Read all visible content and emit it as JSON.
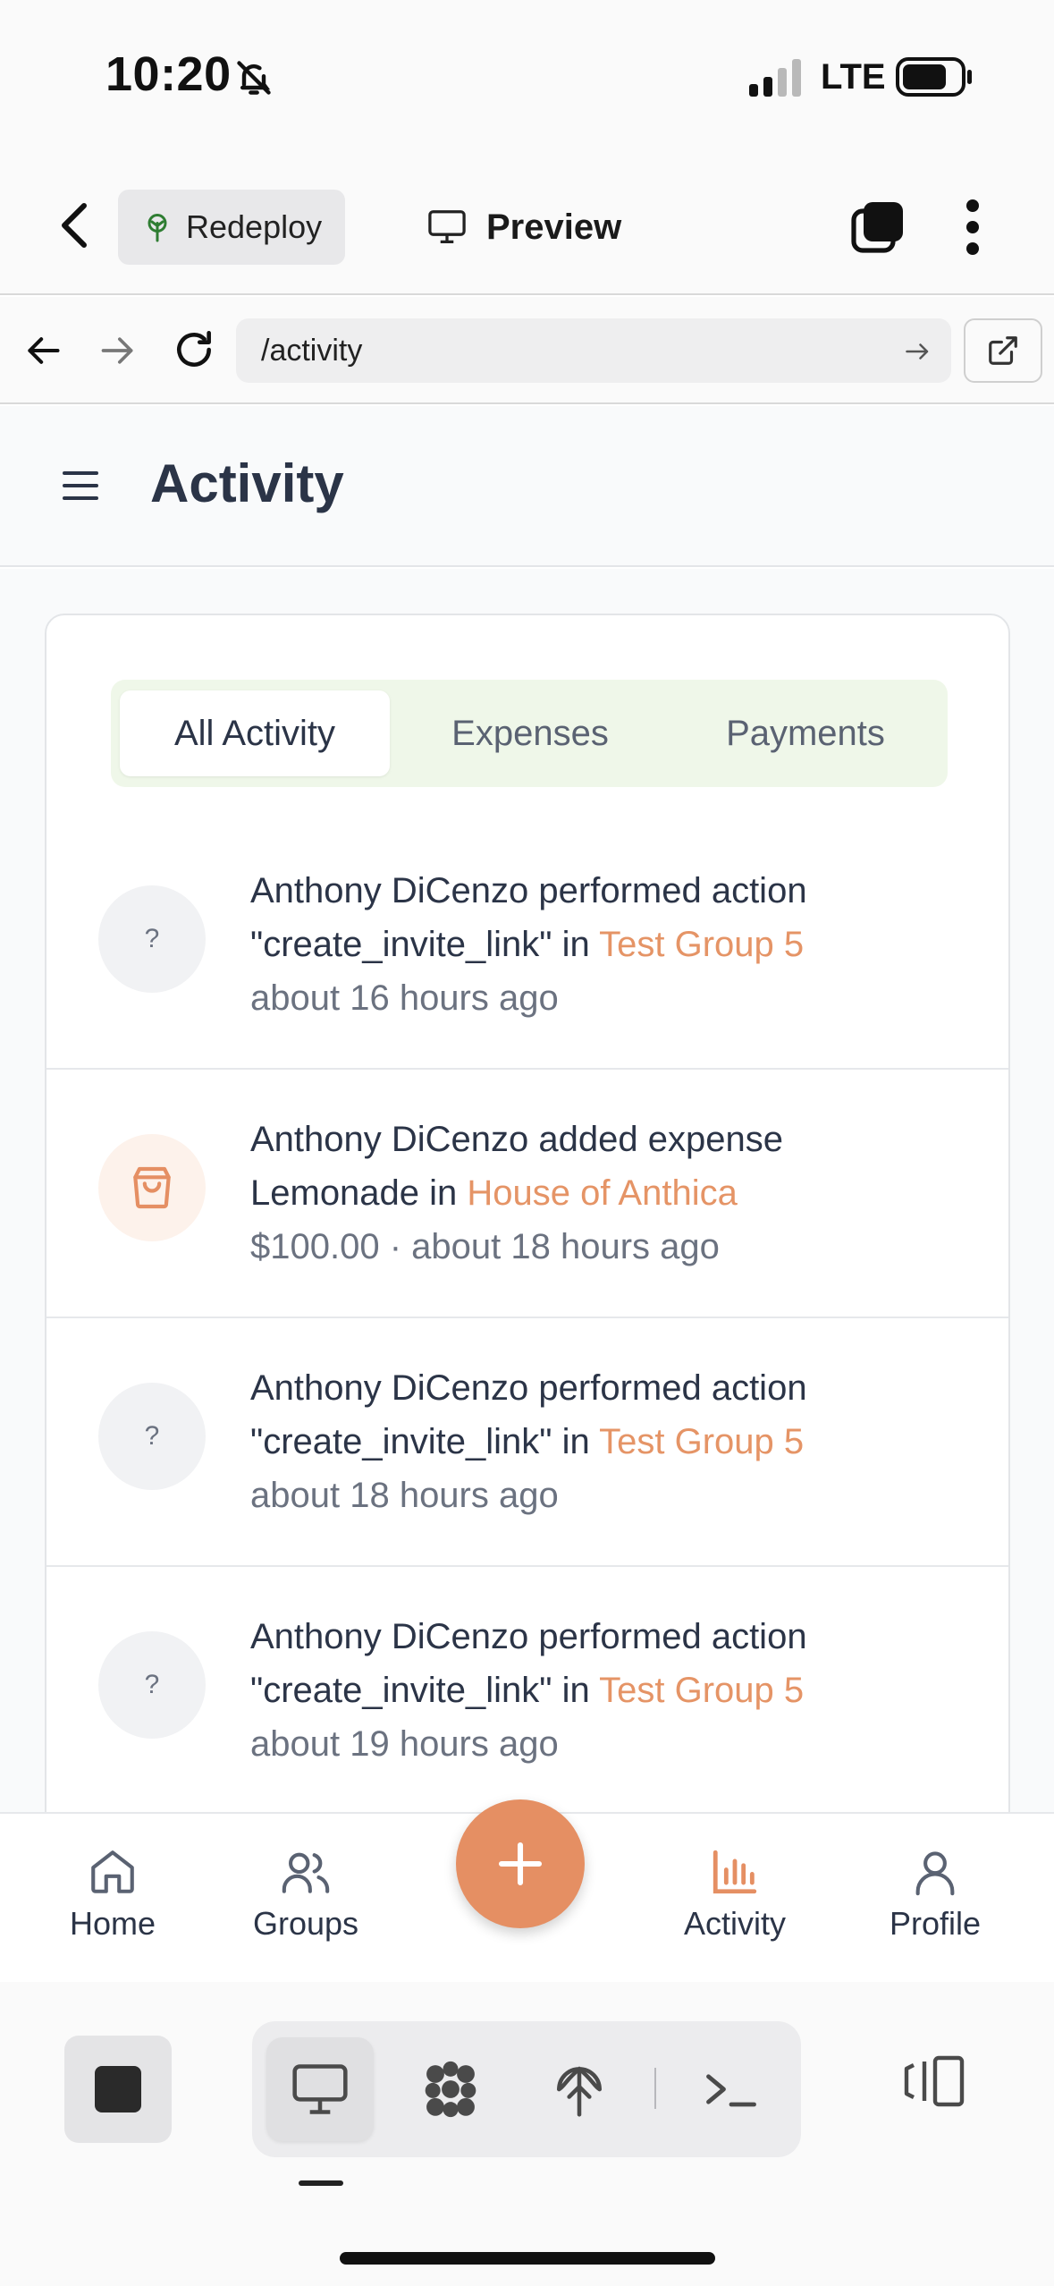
{
  "status_bar": {
    "time": "10:20",
    "network": "LTE"
  },
  "toolbar": {
    "redeploy_label": "Redeploy",
    "preview_label": "Preview"
  },
  "address_bar": {
    "url": "/activity"
  },
  "header": {
    "title": "Activity"
  },
  "filter_tabs": [
    {
      "label": "All Activity",
      "active": true
    },
    {
      "label": "Expenses",
      "active": false
    },
    {
      "label": "Payments",
      "active": false
    }
  ],
  "feed": [
    {
      "avatar": "?",
      "icon": "unknown",
      "line1": "Anthony DiCenzo performed action",
      "line2_prefix": "\"create_invite_link\" in ",
      "group": "Test Group 5",
      "meta": "about 16 hours ago"
    },
    {
      "avatar": "",
      "icon": "shopping-bag-icon",
      "line1": "Anthony DiCenzo added expense",
      "line2_prefix": "Lemonade in ",
      "group": "House of Anthica",
      "meta": "$100.00 · about 18 hours ago"
    },
    {
      "avatar": "?",
      "icon": "unknown",
      "line1": "Anthony DiCenzo performed action",
      "line2_prefix": "\"create_invite_link\" in ",
      "group": "Test Group 5",
      "meta": "about 18 hours ago"
    },
    {
      "avatar": "?",
      "icon": "unknown",
      "line1": "Anthony DiCenzo performed action",
      "line2_prefix": "\"create_invite_link\" in ",
      "group": "Test Group 5",
      "meta": "about 19 hours ago"
    }
  ],
  "bottom_nav": {
    "home": "Home",
    "groups": "Groups",
    "activity": "Activity",
    "profile": "Profile"
  },
  "colors": {
    "accent": "#e58f63",
    "text": "#2b3447",
    "muted": "#6b7280",
    "tab_bg": "#eff7e9"
  }
}
